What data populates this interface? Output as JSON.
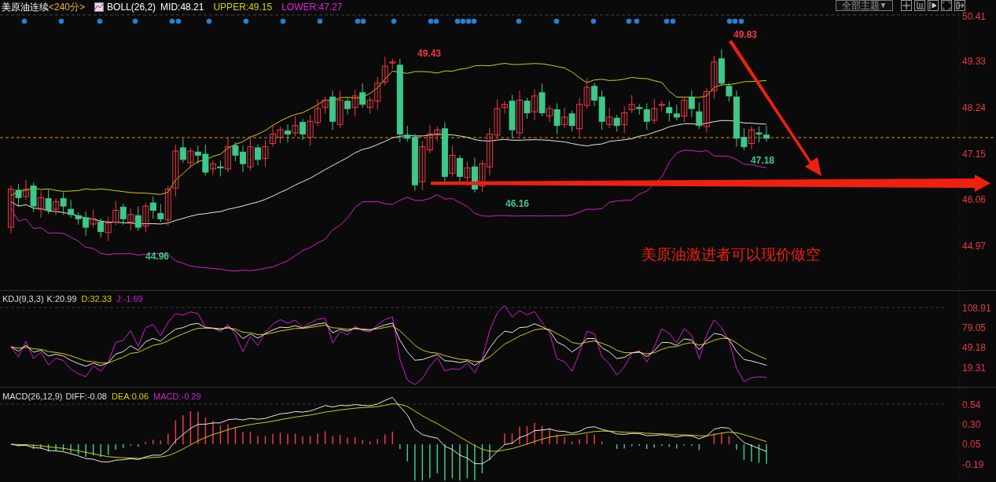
{
  "header": {
    "symbol": "美原油连续",
    "period": "<240分>",
    "indicator": "BOLL(26,2)",
    "mid": "MID:48.21",
    "upper": "UPPER:49.15",
    "lower": "LOWER:47.27"
  },
  "toolbar": {
    "theme_select": "全部主题",
    "theme_arrow": "▼"
  },
  "price_axis": [
    "50.41",
    "49.33",
    "48.24",
    "47.15",
    "46.06",
    "44.97"
  ],
  "price_marks": [
    {
      "text": "49.43",
      "kind": "high"
    },
    {
      "text": "49.83",
      "kind": "high"
    },
    {
      "text": "47.18",
      "kind": "low"
    },
    {
      "text": "44.96",
      "kind": "low"
    },
    {
      "text": "46.16",
      "kind": "low"
    }
  ],
  "annotation": "美原油激进者可以现价做空",
  "kdj": {
    "title": "KDJ(9,3,3)",
    "k": "K:20.99",
    "d": "D:32.33",
    "j": "J:-1.69",
    "axis": [
      "108.91",
      "79.05",
      "49.18",
      "19.31"
    ]
  },
  "macd": {
    "title": "MACD(26,12,9)",
    "diff": "DIFF:-0.08",
    "dea": "DEA:0.06",
    "macd": "MACD:-0.29",
    "axis": [
      "0.54",
      "0.30",
      "0.05",
      "-0.19"
    ]
  }
}
